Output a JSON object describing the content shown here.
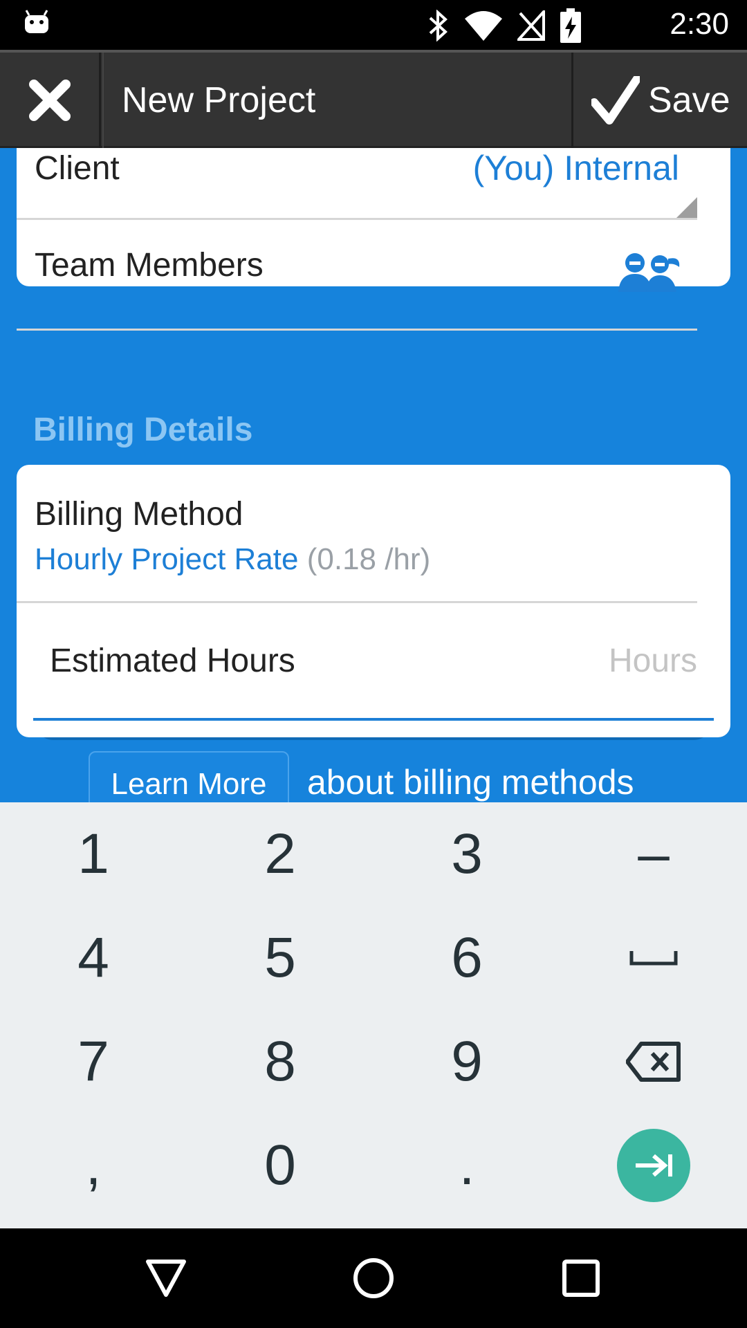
{
  "status_bar": {
    "time": "2:30",
    "icons": [
      "android-icon",
      "bluetooth-icon",
      "wifi-icon",
      "no-signal-icon",
      "battery-charging-icon"
    ]
  },
  "action_bar": {
    "title": "New Project",
    "save_label": "Save"
  },
  "project_card": {
    "client_label": "Client",
    "client_value": "(You) Internal",
    "team_members_label": "Team Members"
  },
  "billing": {
    "section_title": "Billing Details",
    "method_label": "Billing Method",
    "method_value": "Hourly Project Rate",
    "method_rate": "(0.18 /hr)",
    "estimated_hours_label": "Estimated Hours",
    "estimated_hours_placeholder": "Hours",
    "learn_more_label": "Learn More",
    "learn_more_text": "about billing methods"
  },
  "keyboard": {
    "keys": [
      "1",
      "2",
      "3",
      "–",
      "4",
      "5",
      "6",
      "␣",
      "7",
      "8",
      "9",
      "⌫",
      ",",
      "0",
      ".",
      "→|"
    ]
  },
  "colors": {
    "primary_blue": "#1683dc",
    "link_blue": "#1d7fd6",
    "action_green": "#3bb6a0",
    "action_bar": "#333333"
  }
}
